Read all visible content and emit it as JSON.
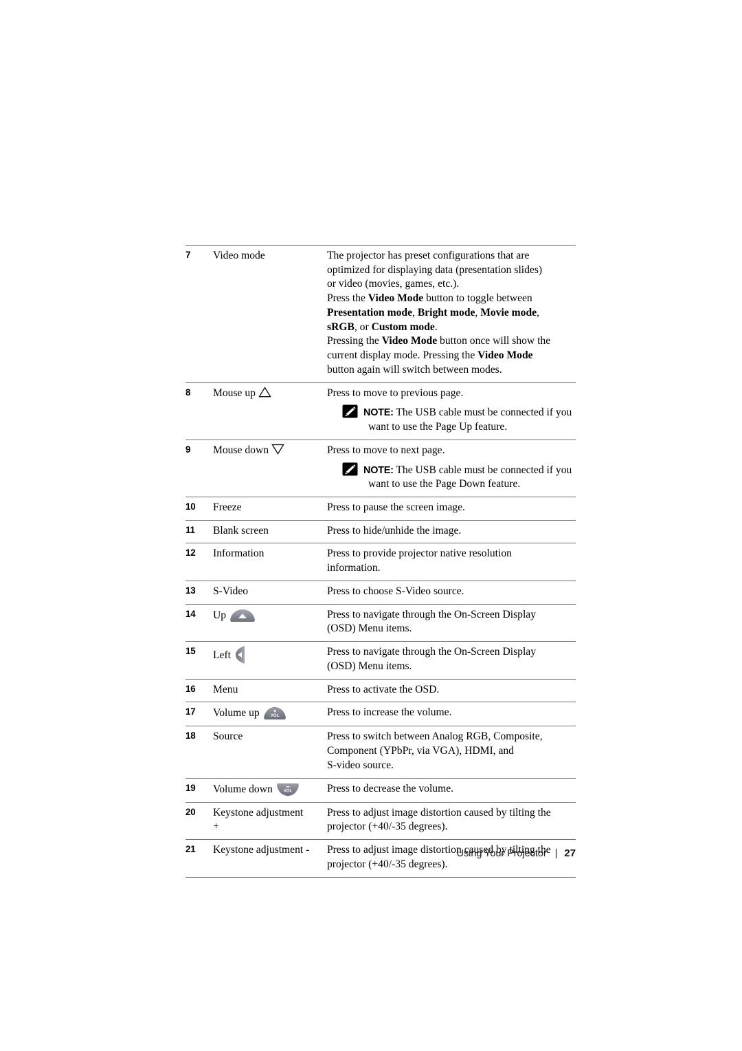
{
  "document": {
    "type": "projector-user-guide-page",
    "footer": {
      "section_title": "Using Your Projector",
      "separator": "|",
      "page_number": "27"
    }
  },
  "colors": {
    "text": "#000000",
    "rule": "#6f6f6f",
    "note_icon_bg": "#000000",
    "button_icon_gray": "#83858f",
    "page_background": "#ffffff"
  },
  "table": {
    "rows": [
      {
        "number": "7",
        "name": "Video mode",
        "name_icon": "",
        "description_lines": [
          {
            "text": "The projector has preset configurations that are"
          },
          {
            "text": "optimized for displaying data (presentation slides)"
          },
          {
            "text": "or video (movies, games, etc.)."
          },
          {
            "segments": [
              {
                "text": "Press the ",
                "bold": false
              },
              {
                "text": "Video Mode",
                "bold": true
              },
              {
                "text": " button to toggle between",
                "bold": false
              }
            ]
          },
          {
            "segments": [
              {
                "text": "Presentation mode",
                "bold": true
              },
              {
                "text": ", ",
                "bold": false
              },
              {
                "text": "Bright mode",
                "bold": true
              },
              {
                "text": ", ",
                "bold": false
              },
              {
                "text": "Movie mode",
                "bold": true
              },
              {
                "text": ",",
                "bold": false
              }
            ]
          },
          {
            "segments": [
              {
                "text": "sRGB",
                "bold": true
              },
              {
                "text": ", or ",
                "bold": false
              },
              {
                "text": "Custom mode",
                "bold": true
              },
              {
                "text": ".",
                "bold": false
              }
            ]
          },
          {
            "segments": [
              {
                "text": "Pressing the ",
                "bold": false
              },
              {
                "text": "Video Mode",
                "bold": true
              },
              {
                "text": " button once will show the",
                "bold": false
              }
            ]
          },
          {
            "segments": [
              {
                "text": "current display mode. Pressing the ",
                "bold": false
              },
              {
                "text": "Video Mode",
                "bold": true
              }
            ]
          },
          {
            "text": "button again will switch between modes."
          }
        ],
        "note": null
      },
      {
        "number": "8",
        "name": "Mouse up",
        "name_icon": "triangle-up-outline-icon",
        "description_lines": [
          {
            "text": "Press to move to previous page."
          }
        ],
        "note": {
          "icon": "note-pencil-icon",
          "label": "NOTE:",
          "text": " The USB cable must be connected if you want to use the Page Up feature."
        }
      },
      {
        "number": "9",
        "name": "Mouse down",
        "name_icon": "triangle-down-outline-icon",
        "description_lines": [
          {
            "text": "Press to move to next page."
          }
        ],
        "note": {
          "icon": "note-pencil-icon",
          "label": "NOTE:",
          "text": " The USB cable must be connected if you want to use the Page Down feature."
        }
      },
      {
        "number": "10",
        "name": "Freeze",
        "name_icon": "",
        "description_lines": [
          {
            "text": "Press to pause the screen image."
          }
        ],
        "note": null
      },
      {
        "number": "11",
        "name": "Blank screen",
        "name_icon": "",
        "description_lines": [
          {
            "text": "Press to hide/unhide the image."
          }
        ],
        "note": null
      },
      {
        "number": "12",
        "name": "Information",
        "name_icon": "",
        "description_lines": [
          {
            "text": "Press to provide projector native resolution"
          },
          {
            "text": "information."
          }
        ],
        "note": null
      },
      {
        "number": "13",
        "name": "S-Video",
        "name_icon": "",
        "description_lines": [
          {
            "text": "Press to choose S-Video source."
          }
        ],
        "note": null
      },
      {
        "number": "14",
        "name": "Up",
        "name_icon": "button-up-arrow-icon",
        "description_lines": [
          {
            "text": "Press to navigate through the On-Screen Display"
          },
          {
            "text": "(OSD) Menu items."
          }
        ],
        "note": null
      },
      {
        "number": "15",
        "name": "Left",
        "name_icon": "button-left-arrow-icon",
        "description_lines": [
          {
            "text": "Press to navigate through the On-Screen Display"
          },
          {
            "text": "(OSD) Menu items."
          }
        ],
        "note": null
      },
      {
        "number": "16",
        "name": "Menu",
        "name_icon": "",
        "description_lines": [
          {
            "text": "Press to activate the OSD."
          }
        ],
        "note": null
      },
      {
        "number": "17",
        "name": "Volume up",
        "name_icon": "button-volume-up-icon",
        "description_lines": [
          {
            "text": "Press to increase the volume."
          }
        ],
        "note": null
      },
      {
        "number": "18",
        "name": "Source",
        "name_icon": "",
        "description_lines": [
          {
            "text": "Press to switch between Analog RGB, Composite,"
          },
          {
            "text": "Component (YPbPr, via VGA), HDMI, and"
          },
          {
            "text": "S-video source."
          }
        ],
        "note": null
      },
      {
        "number": "19",
        "name": "Volume down",
        "name_icon": "button-volume-down-icon",
        "description_lines": [
          {
            "text": "Press to decrease the volume."
          }
        ],
        "note": null
      },
      {
        "number": "20",
        "name": "Keystone adjustment\n+",
        "name_icon": "",
        "description_lines": [
          {
            "text": "Press to adjust image distortion caused by tilting the"
          },
          {
            "text": "projector (+40/-35 degrees)."
          }
        ],
        "note": null
      },
      {
        "number": "21",
        "name": "Keystone adjustment -",
        "name_icon": "",
        "description_lines": [
          {
            "text": "Press to adjust image distortion caused by tilting the"
          },
          {
            "text": "projector (+40/-35 degrees)."
          }
        ],
        "note": null
      }
    ]
  },
  "icon_glyphs": {
    "triangle-up-outline-icon": "△",
    "triangle-down-outline-icon": "▽",
    "note-pencil-icon": "black square with white pencil",
    "button-up-arrow-icon": "gray fan button with white up triangle",
    "button-left-arrow-icon": "gray vertical button with white left triangle",
    "button-volume-up-icon": "gray trapezoid button labeled VOL with plus",
    "button-volume-down-icon": "gray inverted trapezoid button labeled VOL with minus"
  }
}
